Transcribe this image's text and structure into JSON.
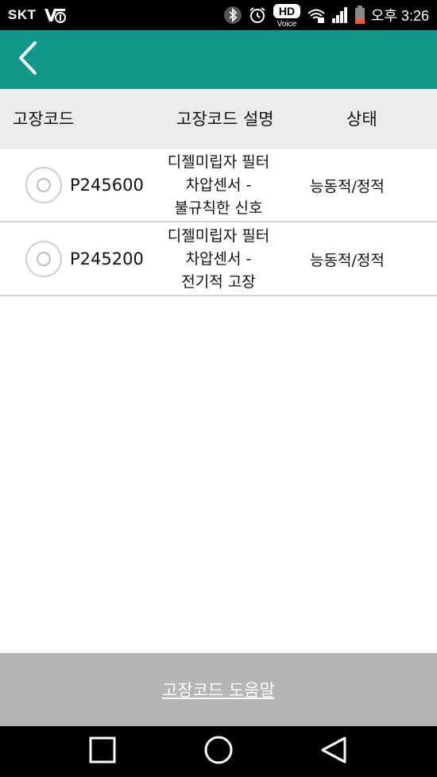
{
  "status_bar": {
    "carrier": "SKT",
    "hd_voice_label": "HD",
    "hd_voice_sub": "Voice",
    "time": "오후 3:26"
  },
  "app_bar": {
    "back_icon": "chevron-left-icon"
  },
  "table": {
    "headers": {
      "code": "고장코드",
      "description": "고장코드 설명",
      "status": "상태"
    },
    "rows": [
      {
        "code": "P245600",
        "description_lines": [
          "디젤미립자 필터",
          "차압센서 -",
          "불규칙한 신호"
        ],
        "status": "능동적/정적"
      },
      {
        "code": "P245200",
        "description_lines": [
          "디젤미립자 필터",
          "차압센서 -",
          "전기적 고장"
        ],
        "status": "능동적/정적"
      }
    ]
  },
  "help_button": {
    "label": "고장코드 도움말"
  },
  "colors": {
    "accent": "#10998a",
    "header_bg": "#ececec",
    "help_bg": "#b5b5b5"
  }
}
